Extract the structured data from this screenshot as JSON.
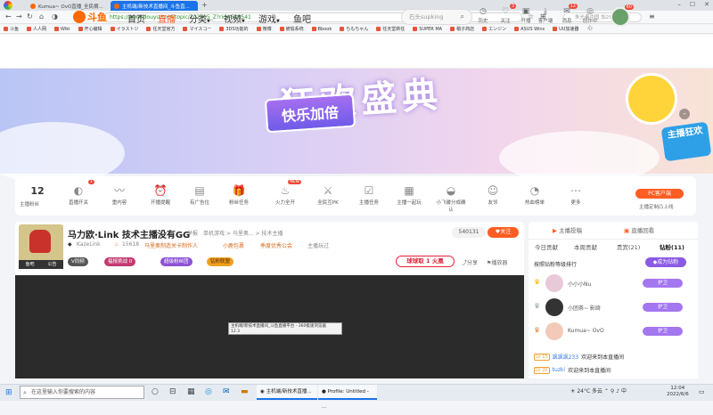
{
  "browser": {
    "tabs": [
      {
        "label": "Kumua~ OvO直播_全民摘..."
      },
      {
        "label": "主机端/新技术直播间_斗鱼直..."
      }
    ],
    "url": "https://www.douyu.com/topic/202205_Z?rid=510541",
    "search_placeholder": "朱光秦中国 加2998磁"
  },
  "bookmarks": [
    "斗鱼",
    "人人网",
    "Wiki",
    "开心编辑",
    "イラストジ",
    "任天堂官方",
    "マイスコー",
    "3DS功能的",
    "微博",
    "被偷系统",
    "Bbook",
    "ちもちゃん",
    "任天堂新任",
    "SUPER MA",
    "稿子商店",
    "エンジン",
    "ASUS Wins",
    "UU加速器"
  ],
  "site": {
    "logo": "斗鱼",
    "nav": [
      "首页",
      "直播",
      "分类",
      "视频",
      "游戏",
      "鱼吧"
    ],
    "search_placeholder": "石头supking",
    "header_icons": [
      {
        "label": "历史",
        "icon": "clock-icon",
        "glyph": "◷"
      },
      {
        "label": "关注",
        "icon": "heart-icon",
        "glyph": "♡",
        "badge": "3"
      },
      {
        "label": "开播",
        "icon": "camera-icon",
        "glyph": "▣"
      },
      {
        "label": "客户端",
        "icon": "download-icon",
        "glyph": "⤓"
      },
      {
        "label": "消息",
        "icon": "bell-icon",
        "glyph": "✉",
        "badge": "12"
      },
      {
        "label": "创作中心",
        "icon": "creator-icon",
        "glyph": "◎"
      }
    ],
    "avatar_badge": "60"
  },
  "banner": {
    "title": "狂欢盛典",
    "subtitle": "快乐加倍",
    "mascot_sign": "主播狂欢"
  },
  "toolbar": {
    "follow_count": "12",
    "follow_label": "主播粉丝",
    "tools": [
      {
        "label": "直播开关",
        "glyph": "◐",
        "badge": "1"
      },
      {
        "label": "重内容",
        "glyph": "〰"
      },
      {
        "label": "开播提醒",
        "glyph": "⏰"
      },
      {
        "label": "有广告位",
        "glyph": "▤"
      },
      {
        "label": "粉丝任务",
        "glyph": "🎁"
      },
      {
        "label": "火力全开",
        "glyph": "♨",
        "badge": "NEW"
      },
      {
        "label": "全民互PK",
        "glyph": "⚔"
      },
      {
        "label": "主播任务",
        "glyph": "☑"
      },
      {
        "label": "主播一起玩",
        "glyph": "▦"
      },
      {
        "label": "小飞碟分成确认",
        "glyph": "◒"
      },
      {
        "label": "友邻",
        "glyph": "☺"
      },
      {
        "label": "热血榜单",
        "glyph": "◔"
      },
      {
        "label": "更多",
        "glyph": "⋯"
      }
    ],
    "pc_download": "PC客户端",
    "pc_subtitle": "主播定制凸上线"
  },
  "room": {
    "title": "马力欧·Link 技术主播没有GG",
    "category_prefix": "举报",
    "category": "单机游戏 > 马里奥... > 技术主播",
    "anchor_name": "KazeLink",
    "hot_count": "15618",
    "anchor_tag": "马里奥制造关卡制作人",
    "anchor_tag2": "小鹿包裹",
    "anchor_tag3": "季度优秀公会",
    "report": "主播玩过",
    "labels": [
      "鱼吧",
      "公告"
    ],
    "chips": [
      "V同频",
      "福报挑战 0",
      "超级粉丝团",
      "钻粉联盟"
    ],
    "room_id": "540131",
    "follow": "关注",
    "hot_bar": "球球取 1 火凰",
    "share": "分享",
    "report_btn": "播放器"
  },
  "side": {
    "tabs": [
      "主播投稿",
      "直播回看"
    ],
    "tabs2": [
      "今日贡献",
      "本周贡献",
      "贵宾(21)",
      "钻粉(11)"
    ],
    "rank_title": "按照钻粉等级排行",
    "become_fan": "成为钻粉",
    "ranks": [
      {
        "name": "小小小Nu",
        "crown": "♛",
        "crown_color": "#f5b400",
        "guard": "护卫"
      },
      {
        "name": "小团茶~ 影绮",
        "crown": "♛",
        "crown_color": "#9aa5b5",
        "guard": "护卫"
      },
      {
        "name": "Kumua~ OvO",
        "crown": "♛",
        "crown_color": "#d98b4a",
        "guard": "护卫"
      }
    ],
    "chats": [
      {
        "level": "LV 15",
        "name": "飒飒飒233",
        "text": "欢迎来到本直播间"
      },
      {
        "level": "LV 20",
        "name": "tuzki",
        "text": "欢迎来到本直播间"
      }
    ]
  },
  "player": {
    "tooltip_line1": "主机端/新技术直播间_斗鱼直播平台 - 360极速浏览器",
    "tooltip_line2": "12.3"
  },
  "taskbar": {
    "search_placeholder": "在这里输入你要搜索的内容",
    "apps": [
      {
        "label": "主机端/新技术直播..."
      },
      {
        "label": "Profile: Untitled - ..."
      }
    ],
    "weather": "24°C 多云",
    "lang": "中",
    "time": "12:04",
    "date": "2022/6/6"
  }
}
